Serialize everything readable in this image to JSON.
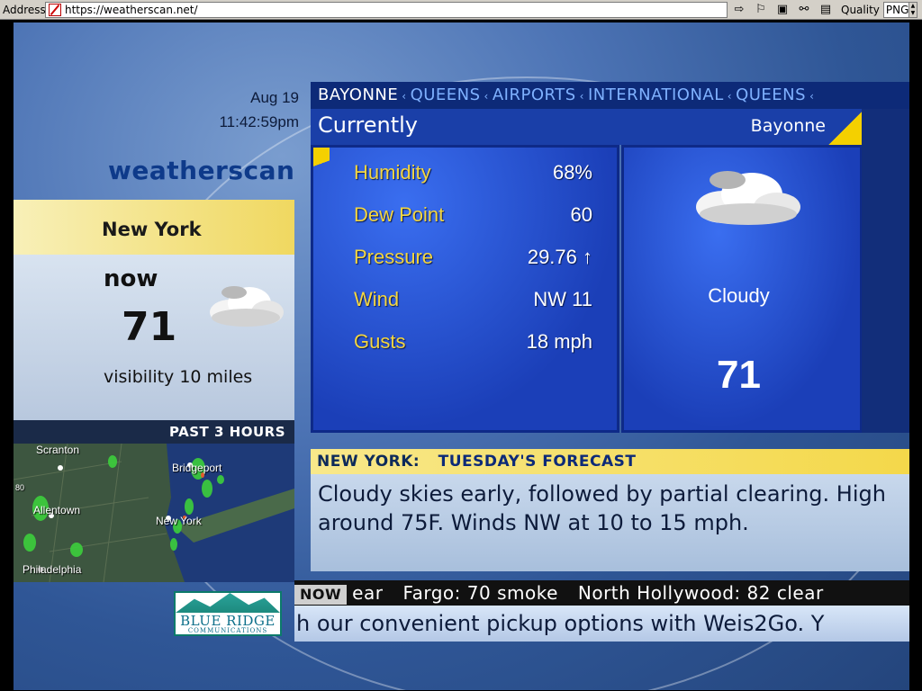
{
  "browser": {
    "address_label": "Address",
    "url": "https://weatherscan.net/",
    "quality_label": "Quality",
    "format": "PNG"
  },
  "header": {
    "date": "Aug 19",
    "time": "11:42:59pm",
    "brand": "weatherscan"
  },
  "local": {
    "city": "New York",
    "now_label": "now",
    "temp": "71",
    "visibility": "visibility 10 miles",
    "icon": "cloud-icon"
  },
  "radar": {
    "title": "PAST 3 HOURS",
    "labels": [
      "Scranton",
      "Bridgeport",
      "Allentown",
      "New York",
      "Philadelphia",
      "80"
    ]
  },
  "breadcrumb": [
    "BAYONNE",
    "QUEENS",
    "AIRPORTS",
    "INTERNATIONAL",
    "QUEENS"
  ],
  "current": {
    "title": "Currently",
    "location": "Bayonne",
    "rows": [
      {
        "label": "Humidity",
        "value": "68%"
      },
      {
        "label": "Dew Point",
        "value": "60"
      },
      {
        "label": "Pressure",
        "value": "29.76 ↑"
      },
      {
        "label": "Wind",
        "value": "NW 11"
      },
      {
        "label": "Gusts",
        "value": "18 mph"
      }
    ],
    "condition": "Cloudy",
    "temp": "71",
    "icon": "cloud-icon"
  },
  "forecast": {
    "city": "NEW YORK:",
    "day": "TUESDAY'S FORECAST",
    "text": "Cloudy skies early, followed by partial clearing. High around 75F. Winds NW at 10 to 15 mph."
  },
  "ticker": {
    "tag": "NOW",
    "items": [
      "ear",
      "Fargo: 70 smoke",
      "North Hollywood: 82 clear"
    ],
    "ad": "h our convenient pickup options with Weis2Go. Y"
  },
  "sponsor": {
    "line1": "BLUE RIDGE",
    "line2": "COMMUNICATIONS"
  },
  "colors": {
    "accent_yellow": "#f4d640",
    "panel_blue": "#1b3fb8",
    "crumb_bg": "#0d2a78"
  }
}
